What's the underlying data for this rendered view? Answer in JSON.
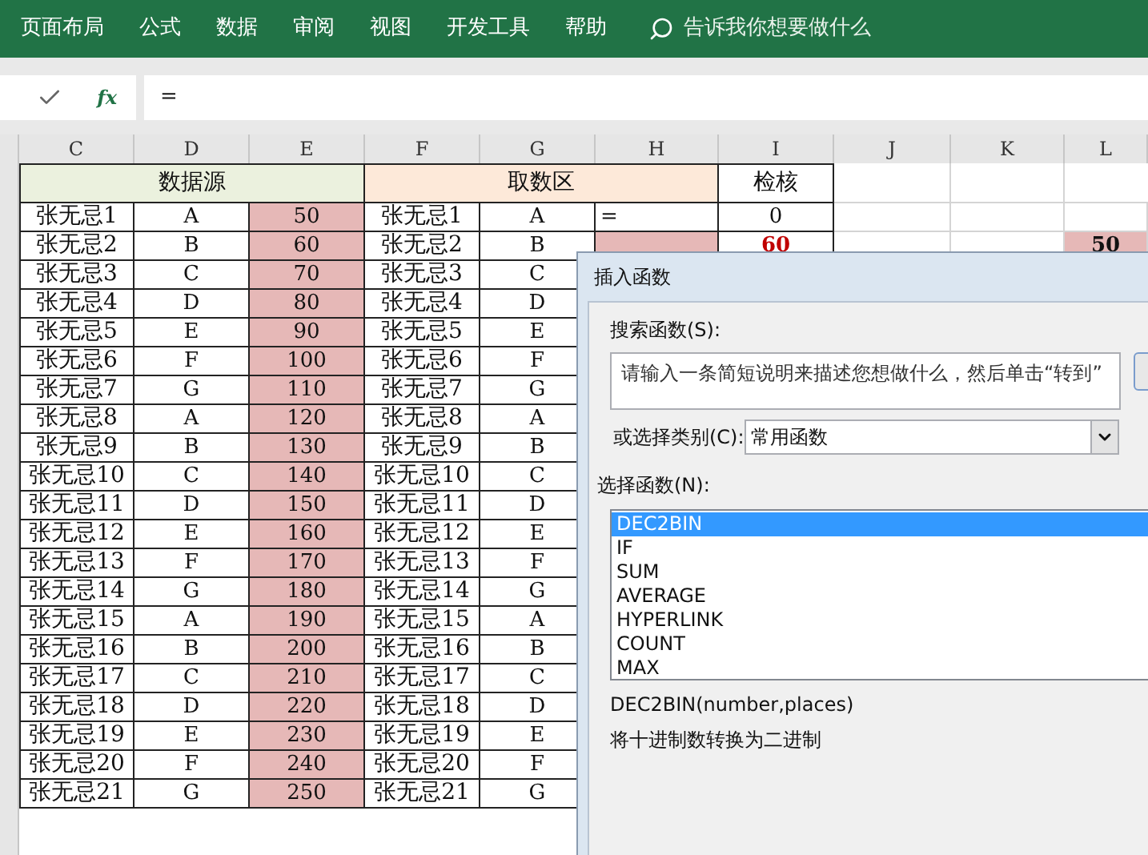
{
  "ribbon_tabs": [
    {
      "label": "页面布局"
    },
    {
      "label": "公式"
    },
    {
      "label": "数据"
    },
    {
      "label": "审阅"
    },
    {
      "label": "视图"
    },
    {
      "label": "开发工具"
    },
    {
      "label": "帮助"
    }
  ],
  "search": {
    "placeholder": "告诉我你想要做什么"
  },
  "formula_bar": {
    "fx_label": "fx",
    "value": "="
  },
  "columns": [
    "C",
    "D",
    "E",
    "F",
    "G",
    "H",
    "I",
    "J",
    "K",
    "L"
  ],
  "header_row": {
    "source": "数据源",
    "pick": "取数区",
    "check": "检核"
  },
  "rows": [
    {
      "c": "张无忌1",
      "d": "A",
      "e": "50",
      "f": "张无忌1",
      "g": "A",
      "h": "=",
      "h_filled": false,
      "i": "0",
      "i_alert": false
    },
    {
      "c": "张无忌2",
      "d": "B",
      "e": "60",
      "f": "张无忌2",
      "g": "B",
      "h_filled": true,
      "i": "60",
      "i_alert": true,
      "l": "50"
    },
    {
      "c": "张无忌3",
      "d": "C",
      "e": "70",
      "f": "张无忌3",
      "g": "C"
    },
    {
      "c": "张无忌4",
      "d": "D",
      "e": "80",
      "f": "张无忌4",
      "g": "D"
    },
    {
      "c": "张无忌5",
      "d": "E",
      "e": "90",
      "f": "张无忌5",
      "g": "E"
    },
    {
      "c": "张无忌6",
      "d": "F",
      "e": "100",
      "f": "张无忌6",
      "g": "F"
    },
    {
      "c": "张无忌7",
      "d": "G",
      "e": "110",
      "f": "张无忌7",
      "g": "G"
    },
    {
      "c": "张无忌8",
      "d": "A",
      "e": "120",
      "f": "张无忌8",
      "g": "A"
    },
    {
      "c": "张无忌9",
      "d": "B",
      "e": "130",
      "f": "张无忌9",
      "g": "B"
    },
    {
      "c": "张无忌10",
      "d": "C",
      "e": "140",
      "f": "张无忌10",
      "g": "C"
    },
    {
      "c": "张无忌11",
      "d": "D",
      "e": "150",
      "f": "张无忌11",
      "g": "D"
    },
    {
      "c": "张无忌12",
      "d": "E",
      "e": "160",
      "f": "张无忌12",
      "g": "E"
    },
    {
      "c": "张无忌13",
      "d": "F",
      "e": "170",
      "f": "张无忌13",
      "g": "F"
    },
    {
      "c": "张无忌14",
      "d": "G",
      "e": "180",
      "f": "张无忌14",
      "g": "G"
    },
    {
      "c": "张无忌15",
      "d": "A",
      "e": "190",
      "f": "张无忌15",
      "g": "A"
    },
    {
      "c": "张无忌16",
      "d": "B",
      "e": "200",
      "f": "张无忌16",
      "g": "B"
    },
    {
      "c": "张无忌17",
      "d": "C",
      "e": "210",
      "f": "张无忌17",
      "g": "C"
    },
    {
      "c": "张无忌18",
      "d": "D",
      "e": "220",
      "f": "张无忌18",
      "g": "D"
    },
    {
      "c": "张无忌19",
      "d": "E",
      "e": "230",
      "f": "张无忌19",
      "g": "E"
    },
    {
      "c": "张无忌20",
      "d": "F",
      "e": "240",
      "f": "张无忌20",
      "g": "F"
    },
    {
      "c": "张无忌21",
      "d": "G",
      "e": "250",
      "f": "张无忌21",
      "g": "G"
    }
  ],
  "dialog": {
    "title": "插入函数",
    "search_label": "搜索函数(S):",
    "search_value": "请输入一条简短说明来描述您想做什么，然后单击“转到”",
    "category_label": "或选择类别(C):",
    "category_value": "常用函数",
    "list_label": "选择函数(N):",
    "functions": [
      {
        "name": "DEC2BIN",
        "selected": true
      },
      {
        "name": "IF",
        "selected": false
      },
      {
        "name": "SUM",
        "selected": false
      },
      {
        "name": "AVERAGE",
        "selected": false
      },
      {
        "name": "HYPERLINK",
        "selected": false
      },
      {
        "name": "COUNT",
        "selected": false
      },
      {
        "name": "MAX",
        "selected": false
      }
    ],
    "signature": "DEC2BIN(number,places)",
    "description": "将十进制数转换为二进制"
  }
}
